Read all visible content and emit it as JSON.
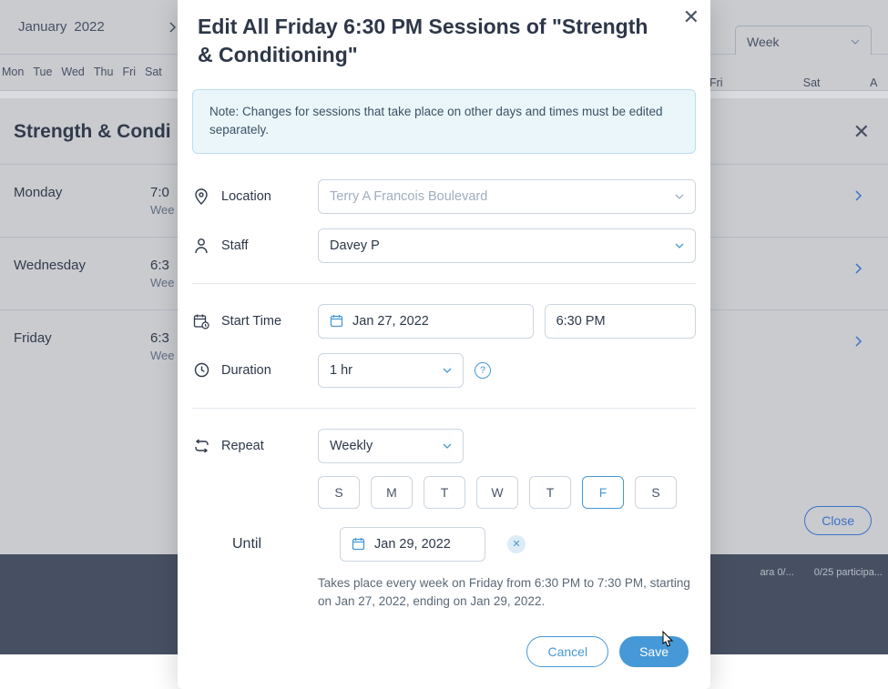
{
  "bg": {
    "month": "January",
    "year": "2022",
    "weekdays": [
      "Mon",
      "Tue",
      "Wed",
      "Thu",
      "Fri",
      "Sat"
    ],
    "calheader": [
      "Fri",
      "Sat",
      "A"
    ],
    "viewmode": "Week",
    "panel_title": "Strength & Condi",
    "rows": [
      {
        "day": "Monday",
        "time": "7:0",
        "sub": "Wee"
      },
      {
        "day": "Wednesday",
        "time": "6:3",
        "sub": "Wee"
      },
      {
        "day": "Friday",
        "time": "6:3",
        "sub": "Wee"
      }
    ],
    "close_btn": "Close",
    "bottom1": "ara 0/...",
    "bottom2": "0/25 participa..."
  },
  "modal": {
    "title": "Edit All Friday 6:30 PM Sessions of \"Strength & Conditioning\"",
    "note": "Note: Changes for sessions that take place on other days and times must be edited separately.",
    "location_label": "Location",
    "location_placeholder": "Terry A Francois Boulevard",
    "staff_label": "Staff",
    "staff_value": "Davey P",
    "start_label": "Start Time",
    "start_date": "Jan 27, 2022",
    "start_time": "6:30 PM",
    "duration_label": "Duration",
    "duration_value": "1 hr",
    "repeat_label": "Repeat",
    "repeat_value": "Weekly",
    "days": [
      "S",
      "M",
      "T",
      "W",
      "T",
      "F",
      "S"
    ],
    "day_active_index": 5,
    "until_label": "Until",
    "until_value": "Jan 29, 2022",
    "summary": "Takes place every week on Friday from 6:30 PM to 7:30 PM, starting on Jan 27, 2022, ending on Jan 29, 2022.",
    "cancel": "Cancel",
    "save": "Save"
  }
}
